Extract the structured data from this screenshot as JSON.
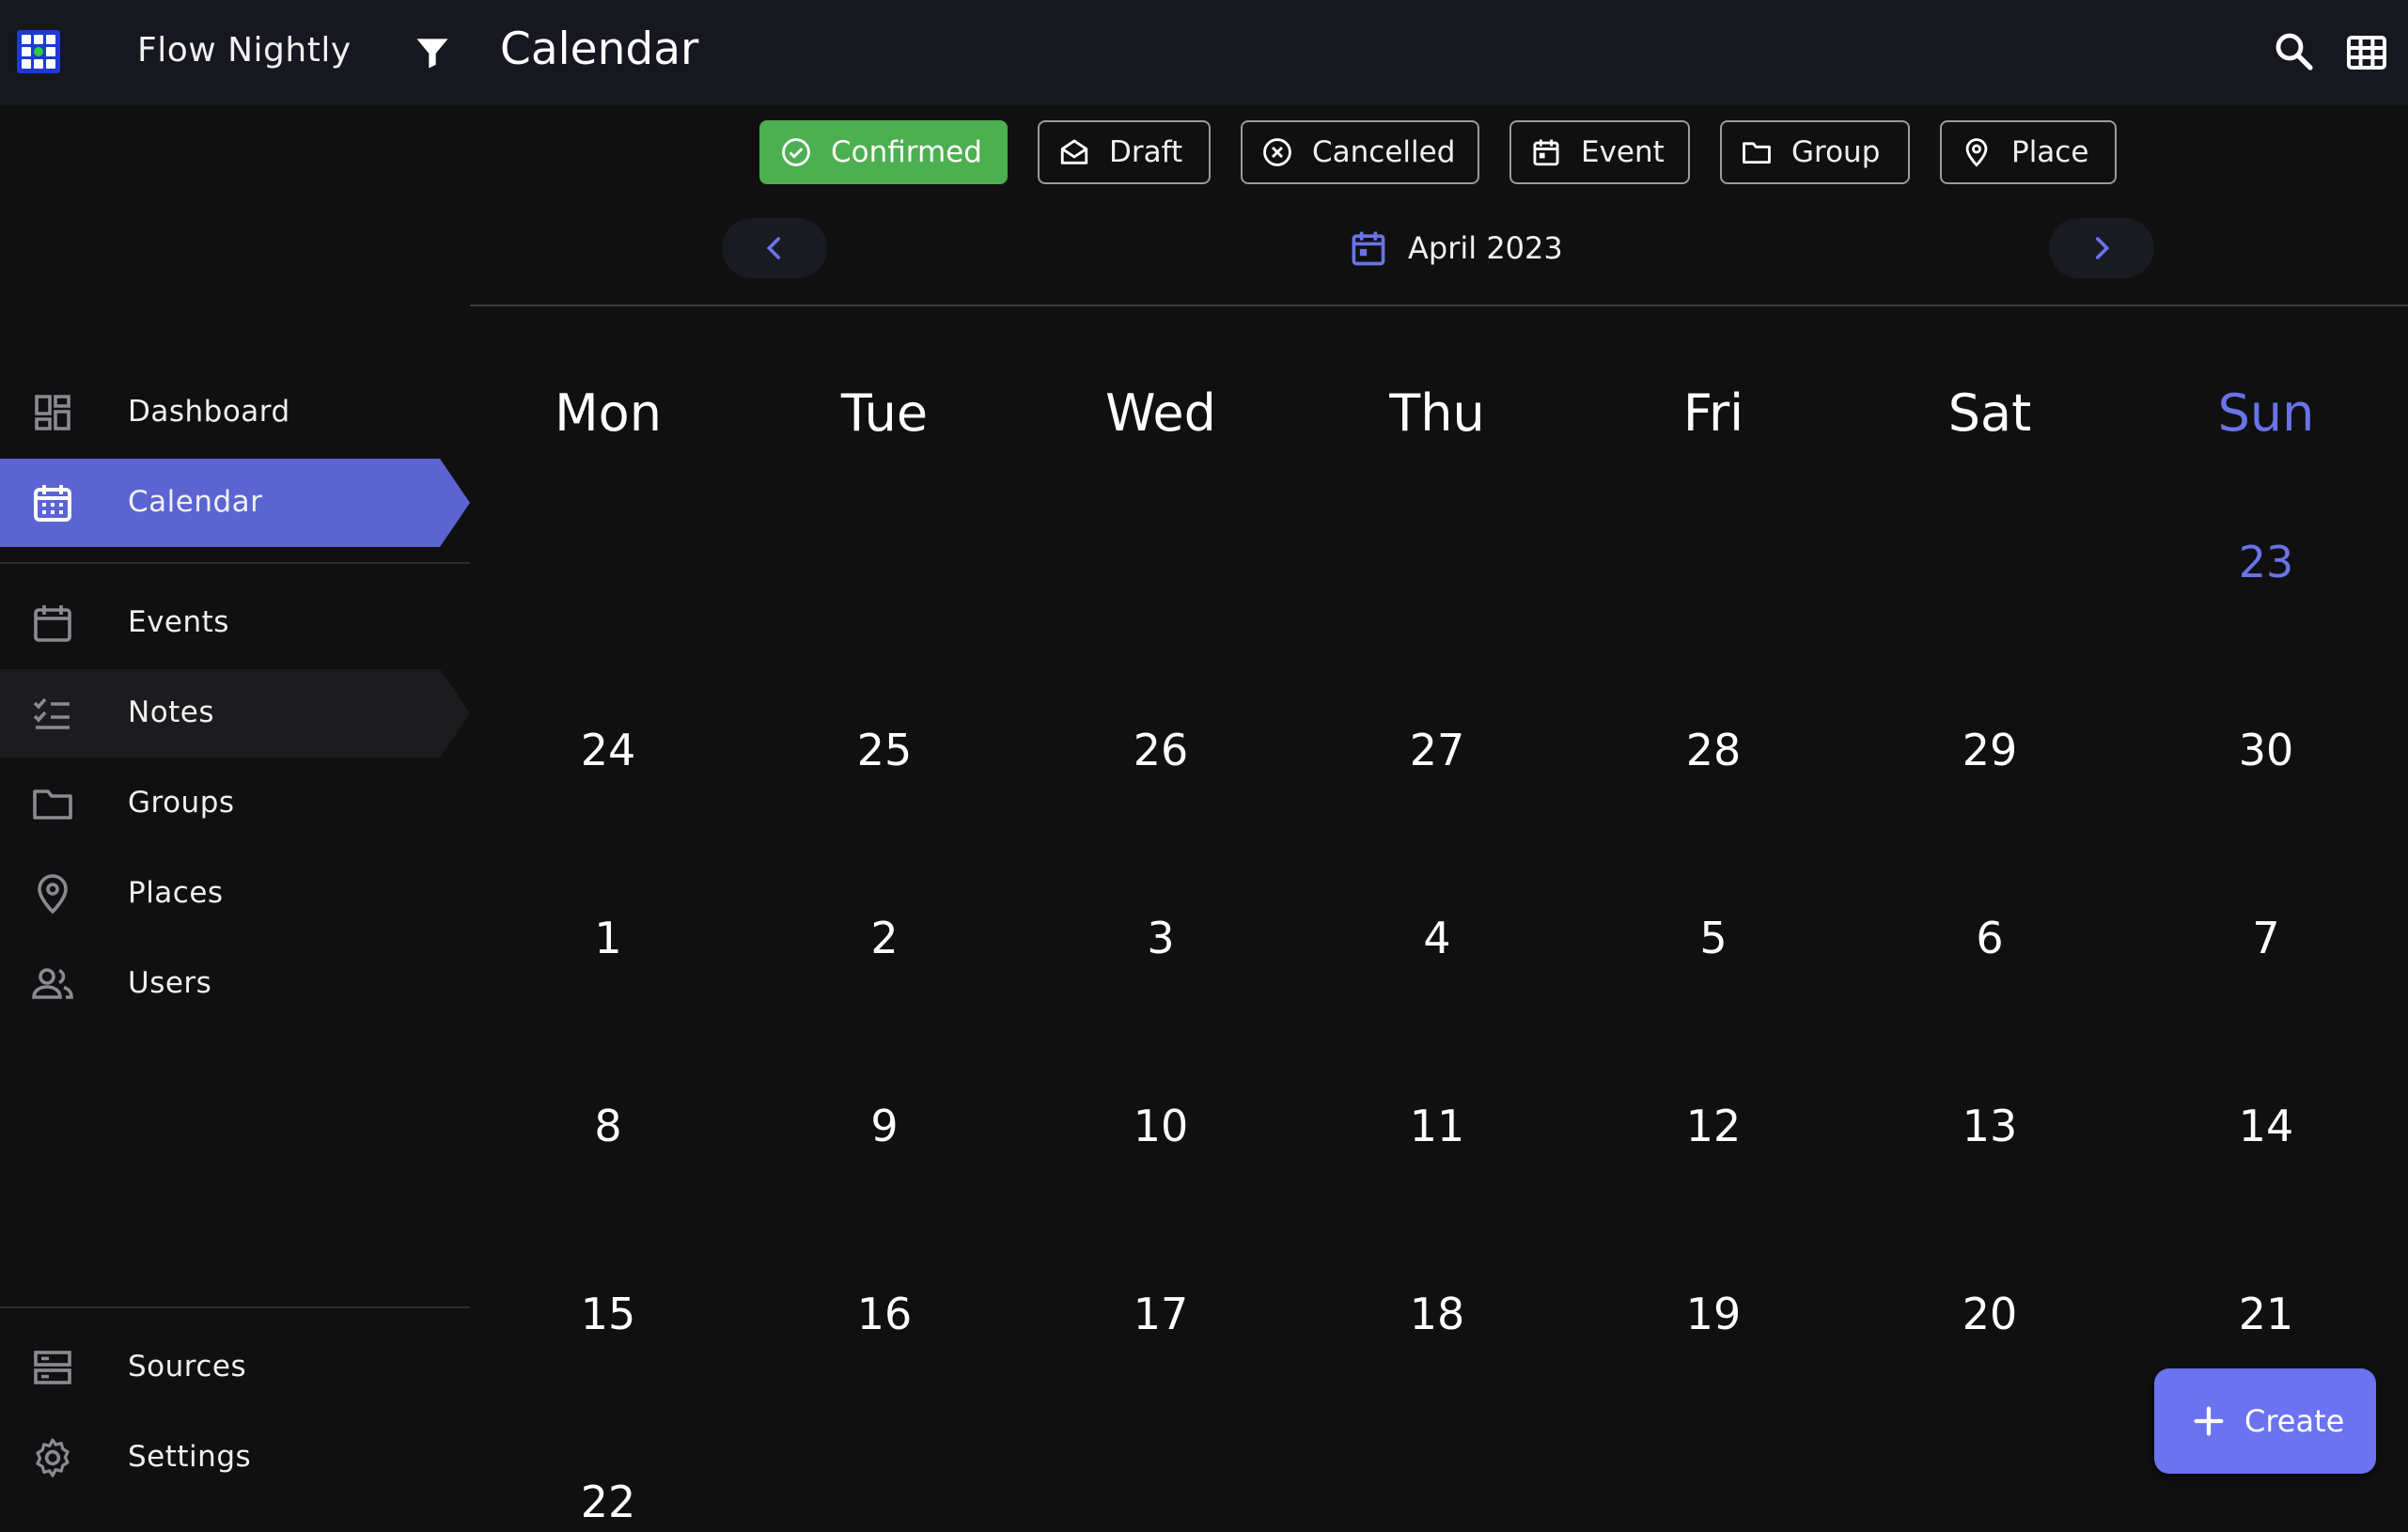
{
  "app": {
    "name": "Flow Nightly",
    "page_title": "Calendar"
  },
  "header_icons": [
    "app-logo-icon",
    "filter-icon",
    "search-icon",
    "apps-grid-icon"
  ],
  "sidebar": {
    "items": [
      {
        "label": "Dashboard",
        "icon": "dashboard-icon"
      },
      {
        "label": "Calendar",
        "icon": "calendar-icon",
        "active": true
      },
      {
        "label": "Events",
        "icon": "event-icon"
      },
      {
        "label": "Notes",
        "icon": "checklist-icon",
        "hover": true
      },
      {
        "label": "Groups",
        "icon": "folder-icon"
      },
      {
        "label": "Places",
        "icon": "place-icon"
      },
      {
        "label": "Users",
        "icon": "users-icon"
      }
    ],
    "footer_items": [
      {
        "label": "Sources",
        "icon": "storage-icon"
      },
      {
        "label": "Settings",
        "icon": "gear-icon"
      }
    ]
  },
  "filters": [
    {
      "label": "Confirmed",
      "icon": "check-circle-icon",
      "selected": true
    },
    {
      "label": "Draft",
      "icon": "draft-mail-icon",
      "selected": false
    },
    {
      "label": "Cancelled",
      "icon": "cancel-circle-icon",
      "selected": false
    },
    {
      "label": "Event",
      "icon": "event-icon",
      "selected": false
    },
    {
      "label": "Group",
      "icon": "folder-icon",
      "selected": false
    },
    {
      "label": "Place",
      "icon": "place-icon",
      "selected": false
    }
  ],
  "calendar": {
    "month_label": "April 2023",
    "weekdays": [
      "Mon",
      "Tue",
      "Wed",
      "Thu",
      "Fri",
      "Sat",
      "Sun"
    ],
    "weeks": [
      [
        "",
        "",
        "",
        "",
        "",
        "",
        "23"
      ],
      [
        "24",
        "25",
        "26",
        "27",
        "28",
        "29",
        "30"
      ],
      [
        "1",
        "2",
        "3",
        "4",
        "5",
        "6",
        "7"
      ],
      [
        "8",
        "9",
        "10",
        "11",
        "12",
        "13",
        "14"
      ],
      [
        "15",
        "16",
        "17",
        "18",
        "19",
        "20",
        "21"
      ],
      [
        "22",
        "",
        "",
        "",
        "",
        "",
        ""
      ]
    ]
  },
  "fab": {
    "label": "Create",
    "icon": "plus-icon"
  },
  "colors": {
    "topbar": "#16171f",
    "background": "#101011",
    "accent": "#5b64d0",
    "sunday": "#6a73e8",
    "confirmed": "#4caf50",
    "fab": "#6b73f0"
  }
}
